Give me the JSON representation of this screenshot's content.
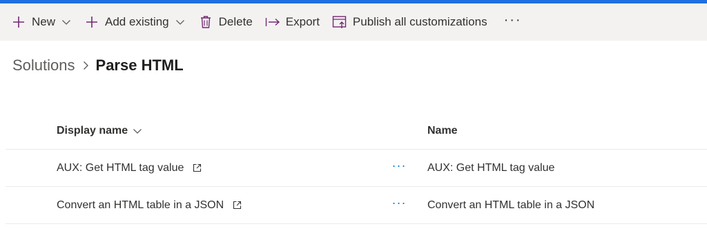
{
  "commandbar": {
    "new_label": "New",
    "add_existing_label": "Add existing",
    "delete_label": "Delete",
    "export_label": "Export",
    "publish_label": "Publish all customizations",
    "more_label": "···"
  },
  "breadcrumb": {
    "parent": "Solutions",
    "current": "Parse HTML"
  },
  "grid": {
    "columns": [
      "Display name",
      "Name"
    ],
    "row_more_label": "···",
    "rows": [
      {
        "display_name": "AUX: Get HTML tag value",
        "name": "AUX: Get HTML tag value"
      },
      {
        "display_name": "Convert an HTML table in a JSON",
        "name": "Convert an HTML table in a JSON"
      }
    ]
  },
  "colors": {
    "accent_bar": "#1f6fe0",
    "icon_purple": "#742774",
    "more_dots_blue": "#0078d4",
    "commandbar_bg": "#f3f2f1"
  },
  "icons": [
    "add-icon",
    "chevron-down-icon",
    "delete-icon",
    "export-icon",
    "publish-icon",
    "chevron-right-icon",
    "open-in-new-icon"
  ]
}
